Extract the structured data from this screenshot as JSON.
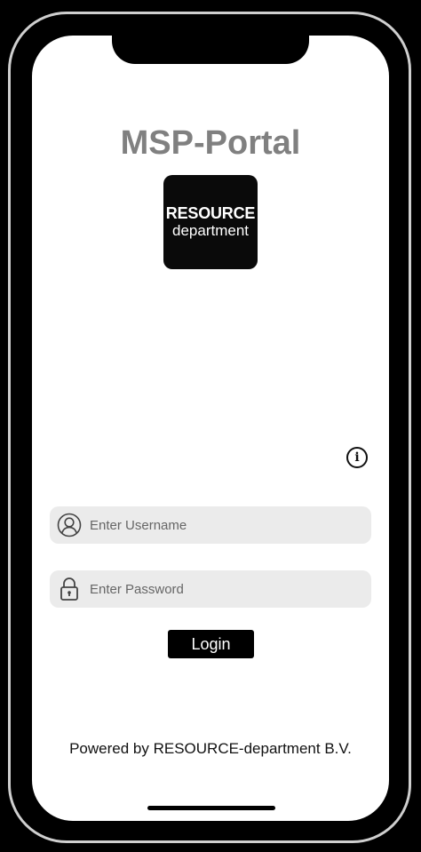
{
  "app": {
    "title": "MSP-Portal"
  },
  "logo": {
    "line1": "RESOURCE",
    "line2": "department"
  },
  "info": {
    "glyph": "i"
  },
  "login_form": {
    "username_placeholder": "Enter Username",
    "password_placeholder": "Enter Password",
    "username_icon": "user-icon",
    "password_icon": "lock-icon",
    "login_label": "Login"
  },
  "footer": {
    "text": "Powered by RESOURCE-department B.V."
  },
  "colors": {
    "title_gray": "#808080",
    "field_bg": "#ebebeb",
    "button_bg": "#000000"
  }
}
